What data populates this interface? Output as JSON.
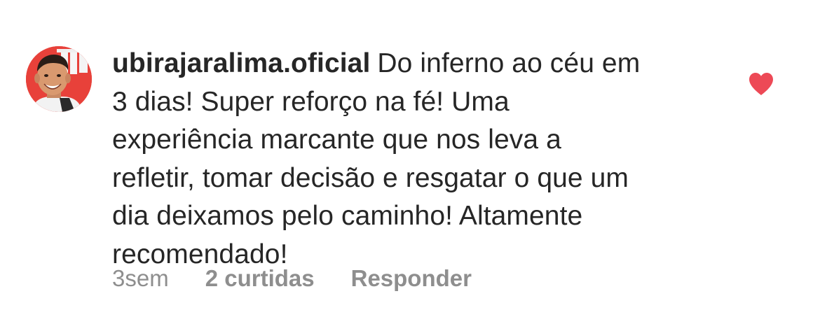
{
  "comment": {
    "avatar_icon": "profile-photo-icon",
    "username": "ubirajaralima.oficial",
    "text_lines": [
      "Do inferno ao céu em",
      "3 dias! Super reforço na fé! Uma",
      "experiência marcante que nos leva a",
      "refletir, tomar decisão e resgatar o que um",
      "dia deixamos pelo caminho! Altamente",
      "recomendado!"
    ],
    "liked": true,
    "heart_icon": "heart-filled-icon",
    "heart_color": "#ed4956",
    "meta": {
      "time": "3sem",
      "likes": "2 curtidas",
      "reply": "Responder"
    }
  }
}
